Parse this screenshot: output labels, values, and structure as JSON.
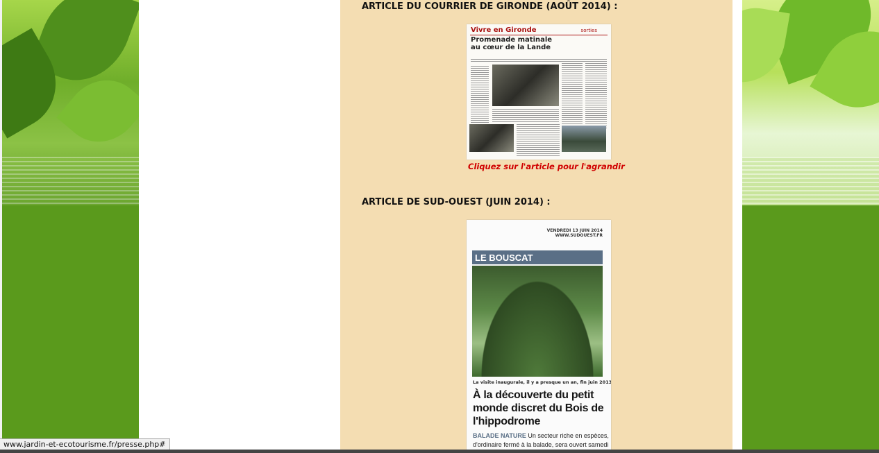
{
  "status_bar": {
    "url": "www.jardin-et-ecotourisme.fr/presse.php#"
  },
  "sections": [
    {
      "heading": "ARTICLE DU COURRIER DE GIRONDE (AOÛT 2014) :",
      "clipping": {
        "kicker": "Vivre en Gironde",
        "kicker_right": "sorties",
        "title": "Promenade matinale au cœur de la Lande"
      },
      "caption": "Cliquez sur l'article pour l'agrandir"
    },
    {
      "heading": "ARTICLE DE SUD-OUEST (JUIN 2014) :",
      "clipping": {
        "date": "VENDREDI 13 JUIN 2014",
        "site": "WWW.SUDOUEST.FR",
        "band": "LE BOUSCAT",
        "legend": "La visite inaugurale, il y a presque un an, fin juin 2013.",
        "headline": "À la découverte du petit monde discret du Bois de l'hippodrome",
        "lead_kicker": "BALADE NATURE",
        "lead_text_1": "Un secteur riche en espèces,",
        "lead_text_2": "d'ordinaire fermé à la balade, sera ouvert samedi"
      }
    }
  ],
  "colors": {
    "content_bg": "#f4ddb2",
    "caption": "#d00000",
    "side_green": "#5a9a1c"
  }
}
